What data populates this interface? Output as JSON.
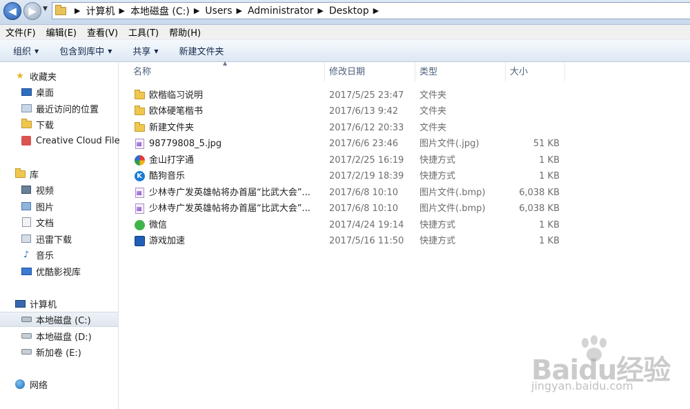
{
  "address": {
    "crumbs": [
      "计算机",
      "本地磁盘 (C:)",
      "Users",
      "Administrator",
      "Desktop"
    ],
    "sep": "▶"
  },
  "menu": [
    "文件(F)",
    "编辑(E)",
    "查看(V)",
    "工具(T)",
    "帮助(H)"
  ],
  "toolbar": {
    "organize": "组织",
    "include_library": "包含到库中",
    "share": "共享",
    "new_folder": "新建文件夹"
  },
  "nav": {
    "favorites": {
      "label": "收藏夹",
      "items": [
        "桌面",
        "最近访问的位置",
        "下载",
        "Creative Cloud Files"
      ]
    },
    "libraries": {
      "label": "库",
      "items": [
        "视频",
        "图片",
        "文档",
        "迅雷下载",
        "音乐",
        "优酷影视库"
      ]
    },
    "computer": {
      "label": "计算机",
      "items": [
        "本地磁盘 (C:)",
        "本地磁盘 (D:)",
        "新加卷 (E:)"
      ]
    },
    "network": {
      "label": "网络"
    }
  },
  "columns": {
    "name": "名称",
    "date": "修改日期",
    "type": "类型",
    "size": "大小"
  },
  "files": [
    {
      "name": "欧楷临习说明",
      "date": "2017/5/25 23:47",
      "type": "文件夹",
      "size": "",
      "icon": "folder"
    },
    {
      "name": "欧体硬笔楷书",
      "date": "2017/6/13 9:42",
      "type": "文件夹",
      "size": "",
      "icon": "folder"
    },
    {
      "name": "新建文件夹",
      "date": "2017/6/12 20:33",
      "type": "文件夹",
      "size": "",
      "icon": "folder"
    },
    {
      "name": "98779808_5.jpg",
      "date": "2017/6/6 23:46",
      "type": "图片文件(.jpg)",
      "size": "51 KB",
      "icon": "image"
    },
    {
      "name": "金山打字通",
      "date": "2017/2/25 16:19",
      "type": "快捷方式",
      "size": "1 KB",
      "icon": "typing-app"
    },
    {
      "name": "酷狗音乐",
      "date": "2017/2/19 18:39",
      "type": "快捷方式",
      "size": "1 KB",
      "icon": "kugou"
    },
    {
      "name": "少林寺广发英雄帖将办首届“比武大会”...",
      "date": "2017/6/8 10:10",
      "type": "图片文件(.bmp)",
      "size": "6,038 KB",
      "icon": "image"
    },
    {
      "name": "少林寺广发英雄帖将办首届“比武大会”...",
      "date": "2017/6/8 10:10",
      "type": "图片文件(.bmp)",
      "size": "6,038 KB",
      "icon": "image"
    },
    {
      "name": "微信",
      "date": "2017/4/24 19:14",
      "type": "快捷方式",
      "size": "1 KB",
      "icon": "wechat"
    },
    {
      "name": "游戏加速",
      "date": "2017/5/16 11:50",
      "type": "快捷方式",
      "size": "1 KB",
      "icon": "game-accel"
    }
  ],
  "watermark": {
    "logo": "Baidu经验",
    "url": "jingyan.baidu.com"
  }
}
